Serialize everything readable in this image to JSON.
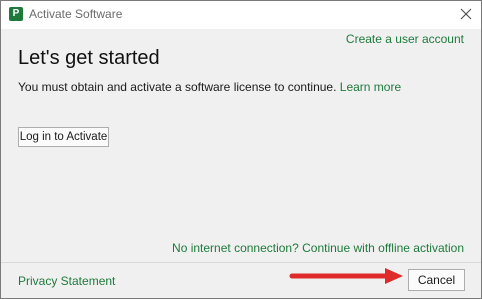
{
  "window": {
    "title": "Activate Software",
    "app_icon_letter": "P",
    "brand_color": "#1e7a3c"
  },
  "header": {
    "create_account_link": "Create a user account"
  },
  "main": {
    "heading": "Let's get started",
    "description": "You must obtain and activate a software license to continue.",
    "learn_more_link": "Learn more",
    "login_button": "Log in to Activate",
    "offline_link": "No internet connection? Continue with offline activation"
  },
  "footer": {
    "privacy_link": "Privacy Statement",
    "cancel_button": "Cancel"
  },
  "annotation": {
    "arrow_color": "#e02b2b",
    "arrow_icon": "red-arrow-right-icon"
  }
}
